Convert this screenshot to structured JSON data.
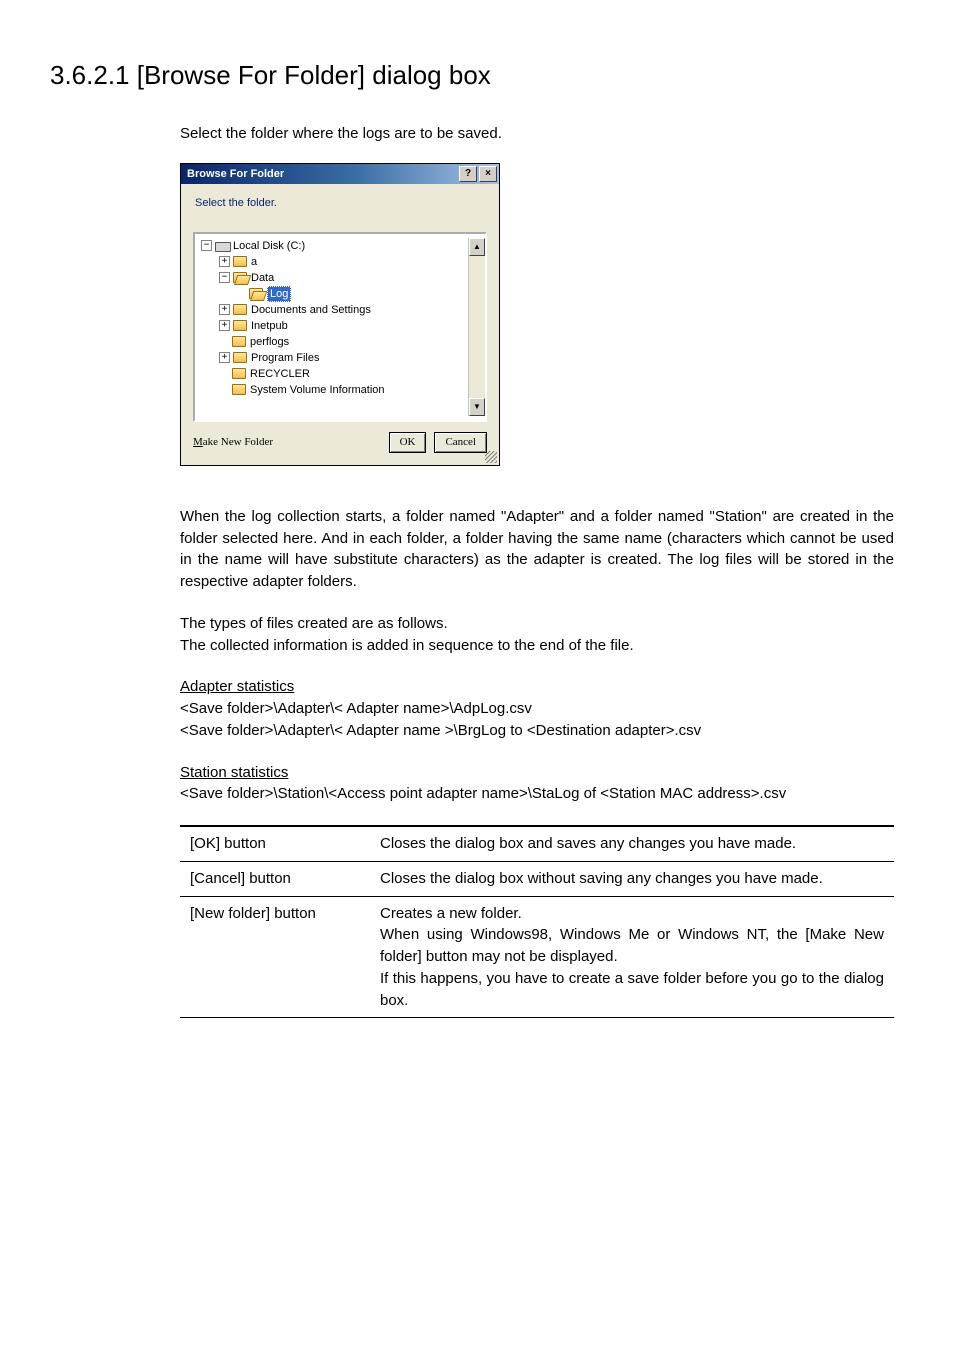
{
  "title": "3.6.2.1 [Browse For Folder] dialog box",
  "lead": "Select the folder where the logs are to be saved.",
  "dialog": {
    "title": "Browse For Folder",
    "help_glyph": "?",
    "close_glyph": "×",
    "message": "Select the folder.",
    "scroll_up": "▲",
    "scroll_down": "▼",
    "tree": {
      "root_expander": "−",
      "root_label": "Local Disk (C:)",
      "a_expander": "+",
      "a_label": "a",
      "data_expander": "−",
      "data_label": "Data",
      "log_label": "Log",
      "docs_expander": "+",
      "docs_label": "Documents and Settings",
      "inet_expander": "+",
      "inet_label": "Inetpub",
      "perf_label": "perflogs",
      "prog_expander": "+",
      "prog_label": "Program Files",
      "rec_label": "RECYCLER",
      "svi_label": "System Volume Information"
    },
    "make_new_accel": "M",
    "make_new_rest": "ake New Folder",
    "ok": "OK",
    "cancel": "Cancel"
  },
  "para1": "When the log collection starts, a folder named \"Adapter\" and a folder named \"Station\" are created in the folder selected here. And in each folder, a folder having the same name (characters which cannot be used in the name will have substitute characters) as the adapter is created. The log files will be stored in the respective adapter folders.",
  "types_line1": "The types of files created are as follows.",
  "types_line2": "The collected information is added in sequence to the end of the file.",
  "adapter_head": "Adapter statistics",
  "adapter_l1": "<Save folder>\\Adapter\\< Adapter name>\\AdpLog.csv",
  "adapter_l2": "<Save folder>\\Adapter\\< Adapter name >\\BrgLog to <Destination adapter>.csv",
  "station_head": "Station statistics",
  "station_l1": "<Save folder>\\Station\\<Access point adapter name>\\StaLog of <Station MAC address>.csv",
  "table": {
    "r1k": "[OK] button",
    "r1v": "Closes the dialog box and saves any changes you have made.",
    "r2k": "[Cancel] button",
    "r2v": "Closes the dialog box without saving any changes you have made.",
    "r3k": "[New folder] button",
    "r3v1": "Creates a new folder.",
    "r3v2": "When using Windows98, Windows Me or Windows NT, the [Make New folder] button may not be displayed.",
    "r3v3": "If this happens, you have to create a save folder before you go to the dialog box."
  }
}
